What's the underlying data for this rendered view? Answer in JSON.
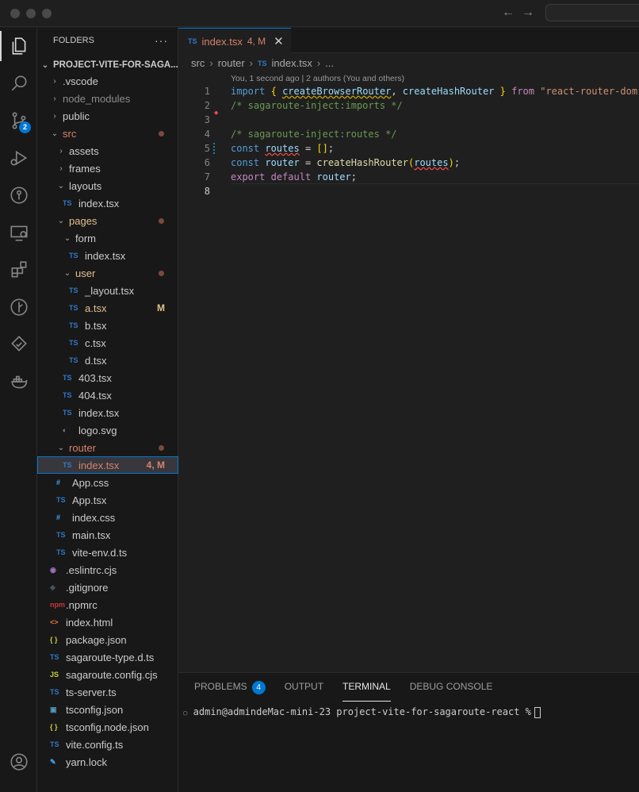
{
  "window": {
    "nav_back": "←",
    "nav_forward": "→"
  },
  "sidebar": {
    "title": "FOLDERS",
    "more": "···",
    "root": "PROJECT-VITE-FOR-SAGA...",
    "items": [
      {
        "label": ".vscode",
        "kind": "folder",
        "depth": 1,
        "expanded": false,
        "color": "#cccccc"
      },
      {
        "label": "node_modules",
        "kind": "folder",
        "depth": 1,
        "expanded": false,
        "color": "#8c8c8c"
      },
      {
        "label": "public",
        "kind": "folder",
        "depth": 1,
        "expanded": false,
        "color": "#cccccc"
      },
      {
        "label": "src",
        "kind": "folder",
        "depth": 1,
        "expanded": true,
        "color": "#e2c08d",
        "dot": true,
        "text_color": "#d7826a"
      },
      {
        "label": "assets",
        "kind": "folder",
        "depth": 2,
        "expanded": false,
        "color": "#cccccc"
      },
      {
        "label": "frames",
        "kind": "folder",
        "depth": 2,
        "expanded": false,
        "color": "#cccccc"
      },
      {
        "label": "layouts",
        "kind": "folder",
        "depth": 2,
        "expanded": true,
        "color": "#cccccc"
      },
      {
        "label": "index.tsx",
        "kind": "ts",
        "depth": 3,
        "color": "#cccccc"
      },
      {
        "label": "pages",
        "kind": "folder",
        "depth": 2,
        "expanded": true,
        "dot": true,
        "text_color": "#e2c08d"
      },
      {
        "label": "form",
        "kind": "folder",
        "depth": 3,
        "expanded": true,
        "color": "#cccccc"
      },
      {
        "label": "index.tsx",
        "kind": "ts",
        "depth": 4,
        "color": "#cccccc"
      },
      {
        "label": "user",
        "kind": "folder",
        "depth": 3,
        "expanded": true,
        "dot": true,
        "text_color": "#e2c08d"
      },
      {
        "label": "_layout.tsx",
        "kind": "ts",
        "depth": 4,
        "color": "#cccccc"
      },
      {
        "label": "a.tsx",
        "kind": "ts",
        "depth": 4,
        "text_color": "#e2c08d",
        "status": "M",
        "status_color": "#e2c08d"
      },
      {
        "label": "b.tsx",
        "kind": "ts",
        "depth": 4,
        "color": "#cccccc"
      },
      {
        "label": "c.tsx",
        "kind": "ts",
        "depth": 4,
        "color": "#cccccc"
      },
      {
        "label": "d.tsx",
        "kind": "ts",
        "depth": 4,
        "color": "#cccccc"
      },
      {
        "label": "403.tsx",
        "kind": "ts",
        "depth": 3,
        "color": "#cccccc"
      },
      {
        "label": "404.tsx",
        "kind": "ts",
        "depth": 3,
        "color": "#cccccc"
      },
      {
        "label": "index.tsx",
        "kind": "ts",
        "depth": 3,
        "color": "#cccccc"
      },
      {
        "label": "logo.svg",
        "kind": "svg",
        "depth": 3,
        "color": "#cccccc"
      },
      {
        "label": "router",
        "kind": "folder",
        "depth": 2,
        "expanded": true,
        "dot": true,
        "text_color": "#d7826a"
      },
      {
        "label": "index.tsx",
        "kind": "ts",
        "depth": 3,
        "text_color": "#d7826a",
        "status": "4, M",
        "status_color": "#d7826a",
        "selected": true
      },
      {
        "label": "App.css",
        "kind": "css",
        "depth": 2,
        "color": "#cccccc"
      },
      {
        "label": "App.tsx",
        "kind": "ts",
        "depth": 2,
        "color": "#cccccc"
      },
      {
        "label": "index.css",
        "kind": "css",
        "depth": 2,
        "color": "#cccccc"
      },
      {
        "label": "main.tsx",
        "kind": "ts",
        "depth": 2,
        "color": "#cccccc"
      },
      {
        "label": "vite-env.d.ts",
        "kind": "ts",
        "depth": 2,
        "color": "#cccccc"
      },
      {
        "label": ".eslintrc.cjs",
        "kind": "eslint",
        "depth": 1,
        "color": "#cccccc"
      },
      {
        "label": ".gitignore",
        "kind": "git",
        "depth": 1,
        "color": "#cccccc"
      },
      {
        "label": ".npmrc",
        "kind": "npm",
        "depth": 1,
        "color": "#cccccc"
      },
      {
        "label": "index.html",
        "kind": "html",
        "depth": 1,
        "color": "#cccccc"
      },
      {
        "label": "package.json",
        "kind": "json",
        "depth": 1,
        "color": "#cccccc"
      },
      {
        "label": "sagaroute-type.d.ts",
        "kind": "ts",
        "depth": 1,
        "color": "#cccccc"
      },
      {
        "label": "sagaroute.config.cjs",
        "kind": "js",
        "depth": 1,
        "color": "#cccccc"
      },
      {
        "label": "ts-server.ts",
        "kind": "ts",
        "depth": 1,
        "color": "#cccccc"
      },
      {
        "label": "tsconfig.json",
        "kind": "tsconfig",
        "depth": 1,
        "color": "#cccccc"
      },
      {
        "label": "tsconfig.node.json",
        "kind": "json",
        "depth": 1,
        "color": "#cccccc"
      },
      {
        "label": "vite.config.ts",
        "kind": "ts",
        "depth": 1,
        "color": "#cccccc"
      },
      {
        "label": "yarn.lock",
        "kind": "yarn",
        "depth": 1,
        "color": "#cccccc"
      }
    ]
  },
  "icons": {
    "ts": "TS",
    "css": "#",
    "json": "{ }",
    "js": "JS",
    "html": "<>",
    "svg": "◐",
    "git": "◆",
    "npm": "npm",
    "eslint": "◉",
    "yarn": "✎",
    "tsconfig": "▣"
  },
  "activity": {
    "scm_badge": "2"
  },
  "editor": {
    "tab": {
      "icon": "TS",
      "name": "index.tsx",
      "status": "4, M",
      "close": "✕"
    },
    "breadcrumb": [
      "src",
      "router",
      "TS",
      "index.tsx",
      "..."
    ],
    "blame": "You, 1 second ago | 2 authors (You and others)",
    "line_numbers": [
      "1",
      "2",
      "3",
      "4",
      "5",
      "6",
      "7",
      "8"
    ],
    "lines": [
      [
        [
          "k",
          "import"
        ],
        [
          "p",
          " "
        ],
        [
          "br",
          "{"
        ],
        [
          "p",
          " "
        ],
        [
          "v wavy-y",
          "createBrowserRouter"
        ],
        [
          "p",
          ", "
        ],
        [
          "v",
          "createHashRouter"
        ],
        [
          "p",
          " "
        ],
        [
          "br",
          "}"
        ],
        [
          "p",
          " "
        ],
        [
          "kc",
          "from"
        ],
        [
          "p",
          " "
        ],
        [
          "s",
          "\"react-router-dom\";"
        ]
      ],
      [
        [
          "c",
          "/* sagaroute-inject:imports */"
        ]
      ],
      [],
      [
        [
          "c",
          "/* sagaroute-inject:routes */"
        ]
      ],
      [
        [
          "k",
          "const"
        ],
        [
          "p",
          " "
        ],
        [
          "v wavy-r",
          "routes"
        ],
        [
          "p",
          " = "
        ],
        [
          "br",
          "[]"
        ],
        [
          "p",
          ";"
        ]
      ],
      [
        [
          "k",
          "const"
        ],
        [
          "p",
          " "
        ],
        [
          "v",
          "router"
        ],
        [
          "p",
          " = "
        ],
        [
          "f",
          "createHashRouter"
        ],
        [
          "br",
          "("
        ],
        [
          "v wavy-r",
          "routes"
        ],
        [
          "br",
          ")"
        ],
        [
          "p",
          ";"
        ]
      ],
      [
        [
          "kc",
          "export"
        ],
        [
          "p",
          " "
        ],
        [
          "kc",
          "default"
        ],
        [
          "p",
          " "
        ],
        [
          "v",
          "router"
        ],
        [
          "p",
          ";"
        ]
      ],
      []
    ]
  },
  "panel": {
    "tabs": [
      "PROBLEMS",
      "OUTPUT",
      "TERMINAL",
      "DEBUG CONSOLE"
    ],
    "problems_count": "4",
    "terminal_line": "admin@admindeMac-mini-23 project-vite-for-sagaroute-react %"
  }
}
